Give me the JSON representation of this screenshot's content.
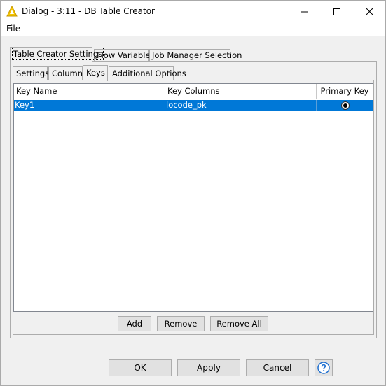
{
  "window": {
    "title": "Dialog - 3:11 - DB Table Creator",
    "icon": "warning-triangle-icon"
  },
  "menu": {
    "file_label": "File"
  },
  "outer_tabs": [
    {
      "label": "Table Creator Settings",
      "active": true
    },
    {
      "label": "Flow Variables",
      "active": false
    },
    {
      "label": "Job Manager Selection",
      "active": false
    }
  ],
  "inner_tabs": [
    {
      "label": "Settings",
      "active": false
    },
    {
      "label": "Columns",
      "active": false
    },
    {
      "label": "Keys",
      "active": true
    },
    {
      "label": "Additional Options",
      "active": false
    }
  ],
  "keys_table": {
    "columns": [
      "Key Name",
      "Key Columns",
      "Primary Key"
    ],
    "rows": [
      {
        "key_name": "Key1",
        "key_columns": "locode_pk",
        "primary_key": true,
        "selected": true
      }
    ]
  },
  "table_buttons": {
    "add": "Add",
    "remove": "Remove",
    "remove_all": "Remove All"
  },
  "dialog_buttons": {
    "ok": "OK",
    "apply": "Apply",
    "cancel": "Cancel",
    "help_icon": "help-icon"
  },
  "colors": {
    "selection": "#0078d7",
    "window_bg": "#f0f0f0",
    "icon_yellow": "#f5c400"
  }
}
